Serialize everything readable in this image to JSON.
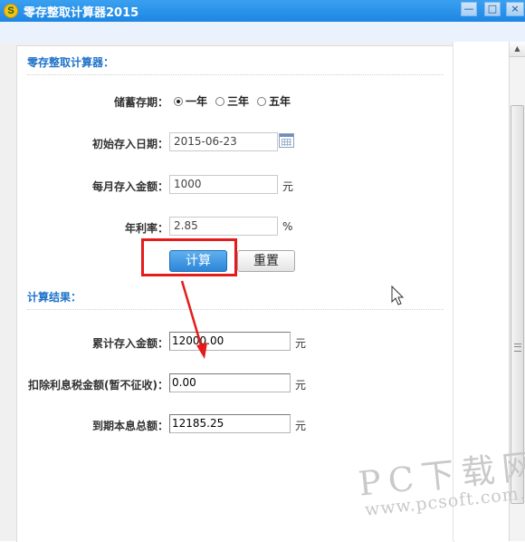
{
  "window": {
    "app_icon": "S",
    "title": "零存整取计算器2015",
    "minimize_icon": "—",
    "maximize_icon": "□",
    "close_icon": "×"
  },
  "form": {
    "section_title": "零存整取计算器：",
    "term": {
      "label": "储蓄存期：",
      "options": [
        "一年",
        "三年",
        "五年"
      ],
      "selected": "一年"
    },
    "start_date": {
      "label": "初始存入日期：",
      "value": "2015-06-23"
    },
    "monthly_deposit": {
      "label": "每月存入金额：",
      "value": "1000",
      "unit": "元"
    },
    "annual_rate": {
      "label": "年利率：",
      "value": "2.85",
      "unit": "%"
    },
    "calculate_label": "计算",
    "reset_label": "重置"
  },
  "results": {
    "section_title": "计算结果：",
    "total_deposit": {
      "label": "累计存入金额：",
      "value": "12000.00",
      "unit": "元"
    },
    "interest_tax": {
      "label": "扣除利息税金额(暂不征收)：",
      "value": "0.00",
      "unit": "元"
    },
    "maturity_total": {
      "label": "到期本息总额：",
      "value": "12185.25",
      "unit": "元"
    }
  },
  "watermark": {
    "brand": "PC下载网",
    "url": "www.pcsoft.com.cn"
  },
  "colors": {
    "titlebar": "#1d86e3",
    "section_title": "#1f73c9",
    "highlight": "#e41b1b",
    "calc_button": "#2c86d9"
  }
}
